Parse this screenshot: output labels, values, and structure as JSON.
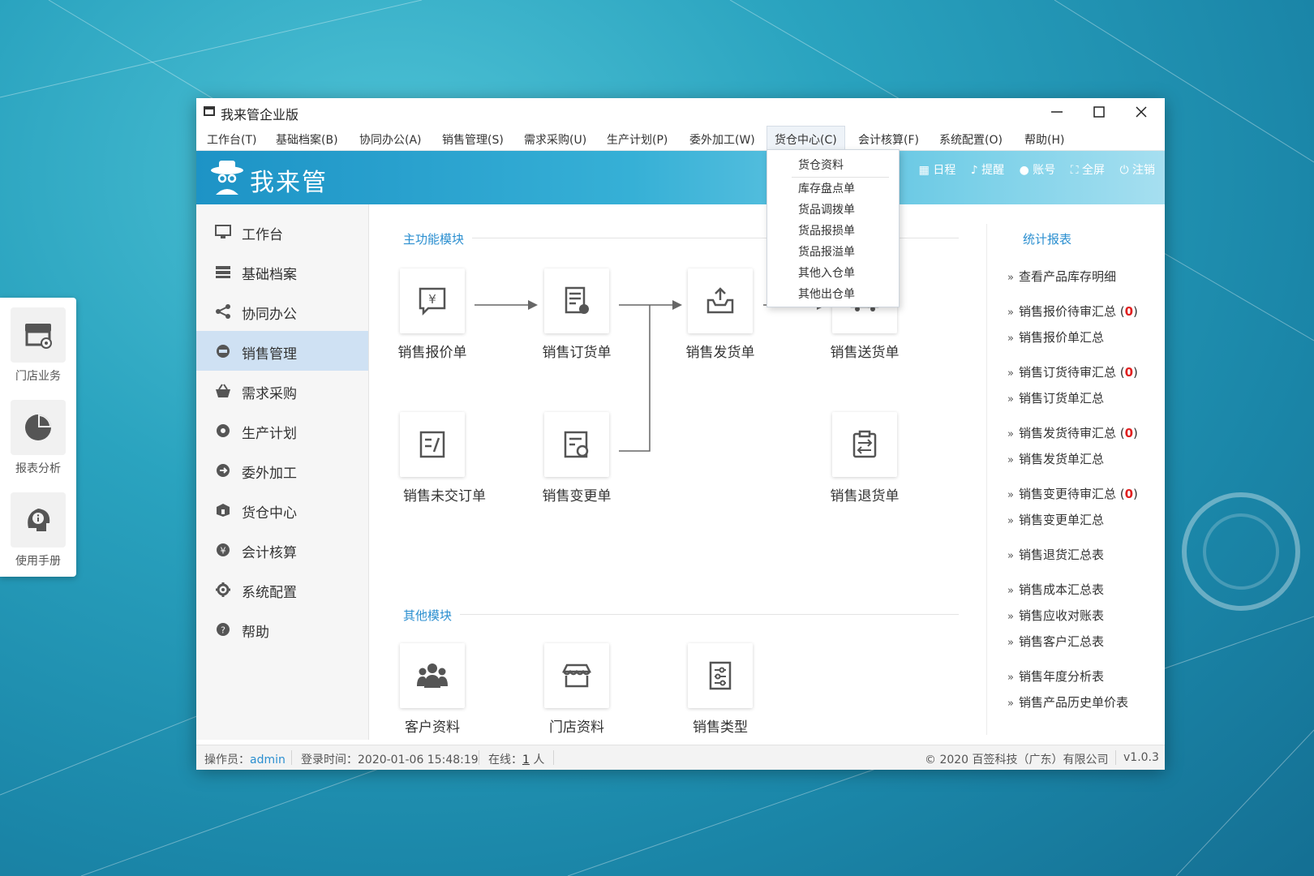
{
  "window": {
    "title": "我来管企业版"
  },
  "menubar": [
    {
      "label": "工作台(T)"
    },
    {
      "label": "基础档案(B)"
    },
    {
      "label": "协同办公(A)"
    },
    {
      "label": "销售管理(S)"
    },
    {
      "label": "需求采购(U)"
    },
    {
      "label": "生产计划(P)"
    },
    {
      "label": "委外加工(W)"
    },
    {
      "label": "货仓中心(C)"
    },
    {
      "label": "会计核算(F)"
    },
    {
      "label": "系统配置(O)"
    },
    {
      "label": "帮助(H)"
    }
  ],
  "dropdown": {
    "items": [
      "货仓资料",
      "库存盘点单",
      "货品调拨单",
      "货品报损单",
      "货品报溢单",
      "其他入仓单",
      "其他出仓单"
    ]
  },
  "banner": {
    "logo_text": "我来管",
    "links": [
      "日程",
      "提醒",
      "账号",
      "全屏",
      "注销"
    ]
  },
  "sidebar": {
    "items": [
      {
        "label": "工作台",
        "icon": "monitor-icon"
      },
      {
        "label": "基础档案",
        "icon": "stack-icon"
      },
      {
        "label": "协同办公",
        "icon": "share-icon"
      },
      {
        "label": "销售管理",
        "icon": "sale-icon"
      },
      {
        "label": "需求采购",
        "icon": "basket-icon"
      },
      {
        "label": "生产计划",
        "icon": "production-icon"
      },
      {
        "label": "委外加工",
        "icon": "outsource-icon"
      },
      {
        "label": "货仓中心",
        "icon": "warehouse-icon"
      },
      {
        "label": "会计核算",
        "icon": "yen-icon"
      },
      {
        "label": "系统配置",
        "icon": "gear-icon"
      },
      {
        "label": "帮助",
        "icon": "help-icon"
      }
    ],
    "active": "销售管理"
  },
  "main": {
    "section_main": "主功能模块",
    "section_other": "其他模块",
    "modules": [
      {
        "label": "销售报价单",
        "icon": "quote-icon"
      },
      {
        "label": "销售订货单",
        "icon": "order-icon"
      },
      {
        "label": "销售发货单",
        "icon": "ship-icon"
      },
      {
        "label": "销售送货单",
        "icon": "delivery-icon"
      },
      {
        "label": "销售未交订单",
        "icon": "pending-order-icon"
      },
      {
        "label": "销售变更单",
        "icon": "change-icon"
      },
      {
        "label": "销售退货单",
        "icon": "return-icon"
      }
    ],
    "other_modules": [
      {
        "label": "客户资料",
        "icon": "customers-icon"
      },
      {
        "label": "门店资料",
        "icon": "store-icon"
      },
      {
        "label": "销售类型",
        "icon": "sales-type-icon"
      }
    ]
  },
  "reports": {
    "title": "统计报表",
    "links": [
      {
        "label": "查看产品库存明细",
        "count": ""
      },
      {
        "label": "销售报价待审汇总",
        "count": "0"
      },
      {
        "label": "销售报价单汇总",
        "count": ""
      },
      {
        "label": "销售订货待审汇总",
        "count": "0"
      },
      {
        "label": "销售订货单汇总",
        "count": ""
      },
      {
        "label": "销售发货待审汇总",
        "count": "0"
      },
      {
        "label": "销售发货单汇总",
        "count": ""
      },
      {
        "label": "销售变更待审汇总",
        "count": "0"
      },
      {
        "label": "销售变更单汇总",
        "count": ""
      },
      {
        "label": "销售退货汇总表",
        "count": ""
      },
      {
        "label": "销售成本汇总表",
        "count": ""
      },
      {
        "label": "销售应收对账表",
        "count": ""
      },
      {
        "label": "销售客户汇总表",
        "count": ""
      },
      {
        "label": "销售年度分析表",
        "count": ""
      },
      {
        "label": "销售产品历史单价表",
        "count": ""
      }
    ]
  },
  "statusbar": {
    "operator_label": "操作员：",
    "operator": "admin",
    "login_label": "登录时间：",
    "login_time": "2020-01-06 15:48:19",
    "online_label": "在线：",
    "online_count": "1",
    "online_unit": "人",
    "copyright": "© 2020 百签科技（广东）有限公司",
    "version": "v1.0.3"
  },
  "float_panel": [
    {
      "label": "门店业务",
      "icon": "store-settings-icon"
    },
    {
      "label": "报表分析",
      "icon": "pie-chart-icon"
    },
    {
      "label": "使用手册",
      "icon": "manual-icon"
    }
  ],
  "colors": {
    "accent": "#2b8fd0",
    "active_nav": "#cfe1f3",
    "badge_red": "#e02020"
  }
}
